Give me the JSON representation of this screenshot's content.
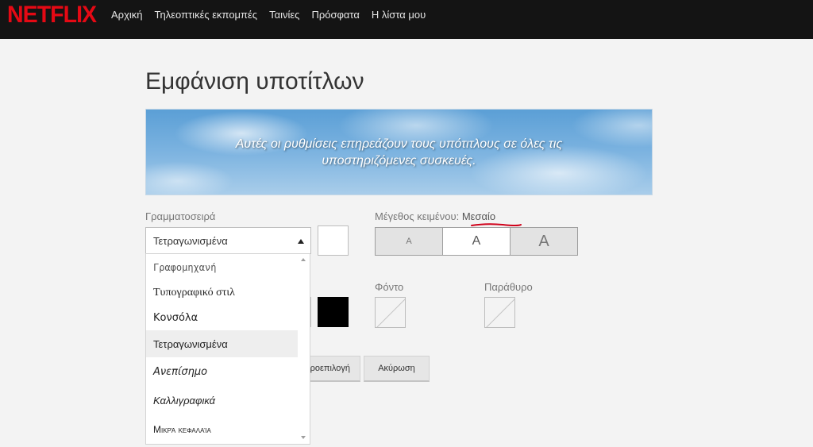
{
  "brand": {
    "logo_text": "NETFLIX",
    "logo_color": "#E50914"
  },
  "nav": {
    "items": [
      "Αρχική",
      "Τηλεοπτικές εκπομπές",
      "Ταινίες",
      "Πρόσφατα",
      "Η λίστα μου"
    ]
  },
  "page": {
    "title": "Εμφάνιση υποτίτλων"
  },
  "banner": {
    "line1": "Αυτές οι ρυθμίσεις επηρεάζουν τους υπότιτλους σε όλες τις",
    "line2": "υποστηριζόμενες συσκευές."
  },
  "font": {
    "label": "Γραμματοσειρά",
    "selected": "Τετραγωνισμένα",
    "options": [
      "Γραφομηχανή",
      "Τυπογραφικό στιλ",
      "Κονσόλα",
      "Τετραγωνισμένα",
      "Ανεπίσημο",
      "Καλλιγραφικά",
      "Μικρά κεφαλαία"
    ],
    "selected_index": 3
  },
  "text_size": {
    "label": "Μέγεθος κειμένου:",
    "value": "Μεσαίο",
    "buttons": [
      "A",
      "A",
      "A"
    ],
    "active_index": 1,
    "annotation_color": "#D0021B"
  },
  "background": {
    "label": "Φόντο"
  },
  "window": {
    "label": "Παράθυρο"
  },
  "actions": {
    "reset_label": "Προεπιλογή",
    "cancel_label": "Ακύρωση"
  },
  "colors": {
    "font_color": "#FFFFFF",
    "shadow_color": "#000000"
  }
}
